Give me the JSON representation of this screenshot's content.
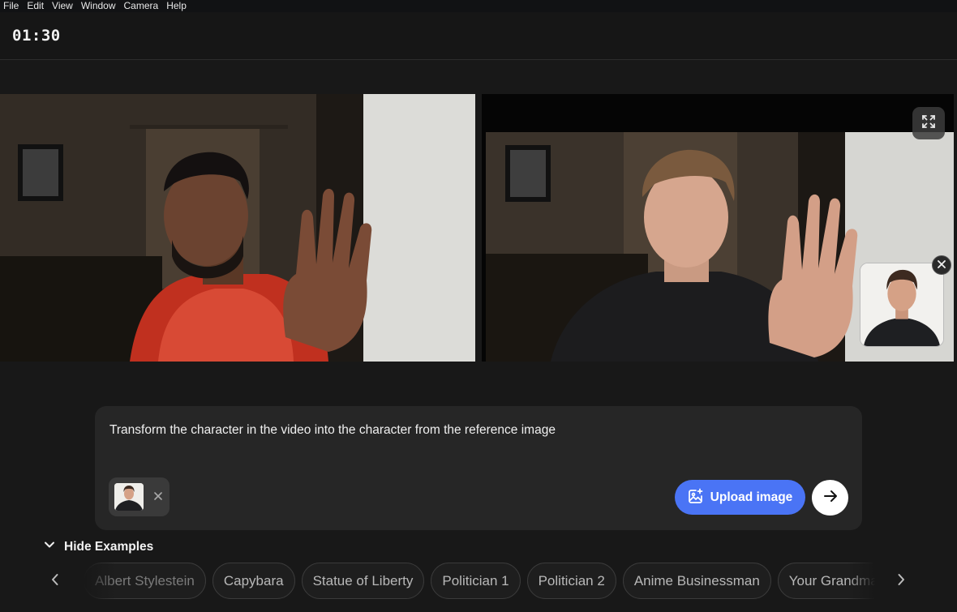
{
  "menu": [
    "File",
    "Edit",
    "View",
    "Window",
    "Camera",
    "Help"
  ],
  "timer": "01:30",
  "prompt": {
    "text": "Transform the character in the video into the character from the reference image",
    "upload_label": "Upload image"
  },
  "examples": {
    "toggle_label": "Hide Examples",
    "items": [
      "Albert Stylestein",
      "Capybara",
      "Statue of Liberty",
      "Politician 1",
      "Politician 2",
      "Anime Businessman",
      "Your Grandma"
    ]
  },
  "icons": {
    "fullscreen": "expand-icon",
    "pip_close": "close-icon",
    "ref_remove": "close-icon",
    "upload": "image-plus-icon",
    "send": "arrow-right-icon",
    "toggle": "chevron-down-icon",
    "prev": "chevron-left-icon",
    "next": "chevron-right-icon"
  },
  "colors": {
    "accent": "#4a74f5",
    "background": "#181818",
    "card": "#262626"
  }
}
